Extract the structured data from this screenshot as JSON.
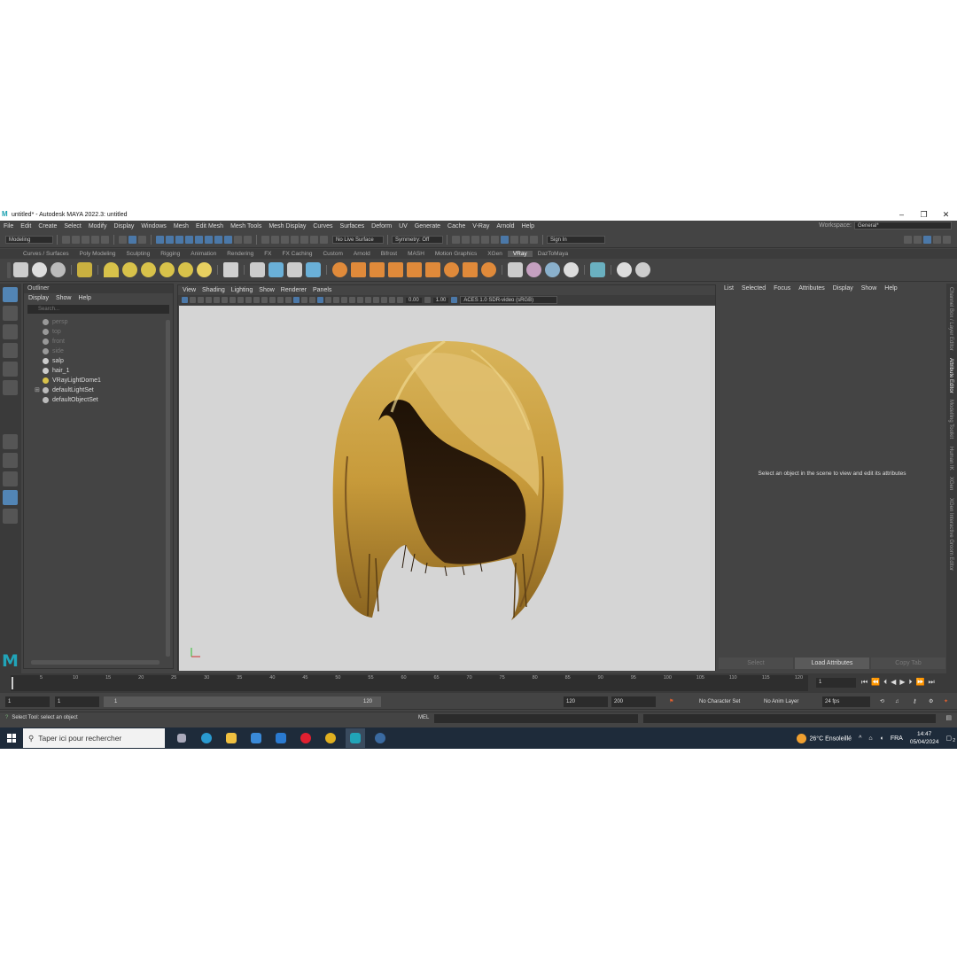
{
  "window": {
    "title": "untitled* - Autodesk MAYA 2022.3: untitled"
  },
  "menus": [
    "File",
    "Edit",
    "Create",
    "Select",
    "Modify",
    "Display",
    "Windows",
    "Mesh",
    "Edit Mesh",
    "Mesh Tools",
    "Mesh Display",
    "Curves",
    "Surfaces",
    "Deform",
    "UV",
    "Generate",
    "Cache",
    "V-Ray",
    "Arnold",
    "Help"
  ],
  "workspace": {
    "label": "Workspace:",
    "value": "General*"
  },
  "statusline": {
    "mode": "Modeling",
    "live_surface": "No Live Surface",
    "symmetry": "Symmetry: Off",
    "sign_in": "Sign In"
  },
  "shelf_tabs": [
    "Curves / Surfaces",
    "Poly Modeling",
    "Sculpting",
    "Rigging",
    "Animation",
    "Rendering",
    "FX",
    "FX Caching",
    "Custom",
    "Arnold",
    "Bifrost",
    "MASH",
    "Motion Graphics",
    "XGen",
    "VRay",
    "DazToMaya"
  ],
  "shelf_active": "VRay",
  "outliner": {
    "title": "Outliner",
    "menu": [
      "Display",
      "Show",
      "Help"
    ],
    "search_placeholder": "Search...",
    "items": [
      {
        "label": "persp",
        "dim": true,
        "icon": "camera-icon"
      },
      {
        "label": "top",
        "dim": true,
        "icon": "camera-icon"
      },
      {
        "label": "front",
        "dim": true,
        "icon": "camera-icon"
      },
      {
        "label": "side",
        "dim": true,
        "icon": "camera-icon"
      },
      {
        "label": "salp",
        "dim": false,
        "icon": "mesh-icon"
      },
      {
        "label": "hair_1",
        "dim": false,
        "icon": "mesh-icon"
      },
      {
        "label": "VRayLightDome1",
        "dim": false,
        "icon": "dome-light-icon"
      },
      {
        "label": "defaultLightSet",
        "dim": false,
        "icon": "set-icon"
      },
      {
        "label": "defaultObjectSet",
        "dim": false,
        "icon": "set-icon"
      }
    ]
  },
  "viewport": {
    "menu": [
      "View",
      "Shading",
      "Lighting",
      "Show",
      "Renderer",
      "Panels"
    ],
    "exposure": "0.00",
    "gamma": "1.00",
    "color_space": "ACES 1.0 SDR-video (sRGB)"
  },
  "attribute_editor": {
    "menu": [
      "List",
      "Selected",
      "Focus",
      "Attributes",
      "Display",
      "Show",
      "Help"
    ],
    "message": "Select an object in the scene to view and edit its attributes",
    "buttons": [
      "Select",
      "Load Attributes",
      "Copy Tab"
    ]
  },
  "side_tabs": [
    "Channel Box / Layer Editor",
    "Attribute Editor",
    "Modelling Toolkit",
    "Human IK",
    "XGen",
    "XGen Interactive Groom Editor"
  ],
  "timeline": {
    "ticks": [
      "5",
      "10",
      "15",
      "20",
      "25",
      "30",
      "35",
      "40",
      "45",
      "50",
      "55",
      "60",
      "65",
      "70",
      "75",
      "80",
      "85",
      "90",
      "95",
      "100",
      "105",
      "110",
      "115",
      "120"
    ],
    "current_frame": "1"
  },
  "range": {
    "start": "1",
    "anim_start": "1",
    "range_start_label": "1",
    "range_end_label": "120",
    "end": "120",
    "anim_end": "200",
    "character_set": "No Character Set",
    "anim_layer": "No Anim Layer",
    "fps": "24 fps"
  },
  "command_line": {
    "help": "Select Tool: select an object",
    "lang": "MEL"
  },
  "taskbar": {
    "search_placeholder": "Taper ici pour rechercher",
    "weather": "26°C  Ensoleillé",
    "lang": "FRA",
    "time": "14:47",
    "date": "05/04/2024",
    "notifications": "2"
  }
}
